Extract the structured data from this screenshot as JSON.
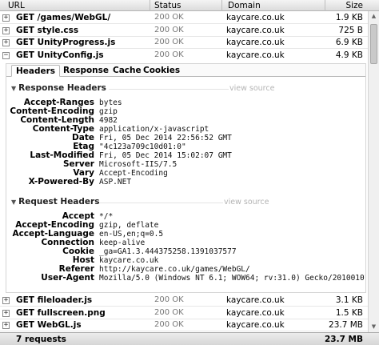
{
  "columns": {
    "url": "URL",
    "status": "Status",
    "domain": "Domain",
    "size": "Size"
  },
  "requests_top": [
    {
      "expander": "+",
      "method_url": "GET /games/WebGL/",
      "status": "200 OK",
      "domain": "kaycare.co.uk",
      "size": "1.9 KB"
    },
    {
      "expander": "+",
      "method_url": "GET style.css",
      "status": "200 OK",
      "domain": "kaycare.co.uk",
      "size": "725 B"
    },
    {
      "expander": "+",
      "method_url": "GET UnityProgress.js",
      "status": "200 OK",
      "domain": "kaycare.co.uk",
      "size": "6.9 KB"
    },
    {
      "expander": "−",
      "method_url": "GET UnityConfig.js",
      "status": "200 OK",
      "domain": "kaycare.co.uk",
      "size": "4.9 KB"
    }
  ],
  "tabs": [
    "Headers",
    "Response",
    "Cache",
    "Cookies"
  ],
  "response_headers": {
    "title": "Response Headers",
    "view_source": "view source",
    "items": [
      {
        "name": "Accept-Ranges",
        "value": "bytes"
      },
      {
        "name": "Content-Encoding",
        "value": "gzip"
      },
      {
        "name": "Content-Length",
        "value": "4982"
      },
      {
        "name": "Content-Type",
        "value": "application/x-javascript"
      },
      {
        "name": "Date",
        "value": "Fri, 05 Dec 2014 22:56:52 GMT"
      },
      {
        "name": "Etag",
        "value": "\"4c123a709c10d01:0\""
      },
      {
        "name": "Last-Modified",
        "value": "Fri, 05 Dec 2014 15:02:07 GMT"
      },
      {
        "name": "Server",
        "value": "Microsoft-IIS/7.5"
      },
      {
        "name": "Vary",
        "value": "Accept-Encoding"
      },
      {
        "name": "X-Powered-By",
        "value": "ASP.NET"
      }
    ]
  },
  "request_headers": {
    "title": "Request Headers",
    "view_source": "view source",
    "items": [
      {
        "name": "Accept",
        "value": "*/*"
      },
      {
        "name": "Accept-Encoding",
        "value": "gzip, deflate"
      },
      {
        "name": "Accept-Language",
        "value": "en-US,en;q=0.5"
      },
      {
        "name": "Connection",
        "value": "keep-alive"
      },
      {
        "name": "Cookie",
        "value": "_ga=GA1.3.444375258.1391037577"
      },
      {
        "name": "Host",
        "value": "kaycare.co.uk"
      },
      {
        "name": "Referer",
        "value": "http://kaycare.co.uk/games/WebGL/"
      },
      {
        "name": "User-Agent",
        "value": "Mozilla/5.0 (Windows NT 6.1; WOW64; rv:31.0) Gecko/20100101 Fi"
      }
    ]
  },
  "requests_bottom": [
    {
      "expander": "+",
      "method_url": "GET fileloader.js",
      "status": "200 OK",
      "domain": "kaycare.co.uk",
      "size": "3.1 KB"
    },
    {
      "expander": "+",
      "method_url": "GET fullscreen.png",
      "status": "200 OK",
      "domain": "kaycare.co.uk",
      "size": "1.5 KB"
    },
    {
      "expander": "+",
      "method_url": "GET WebGL.js",
      "status": "200 OK",
      "domain": "kaycare.co.uk",
      "size": "23.7 MB"
    }
  ],
  "footer": {
    "count": "7 requests",
    "total": "23.7 MB"
  }
}
